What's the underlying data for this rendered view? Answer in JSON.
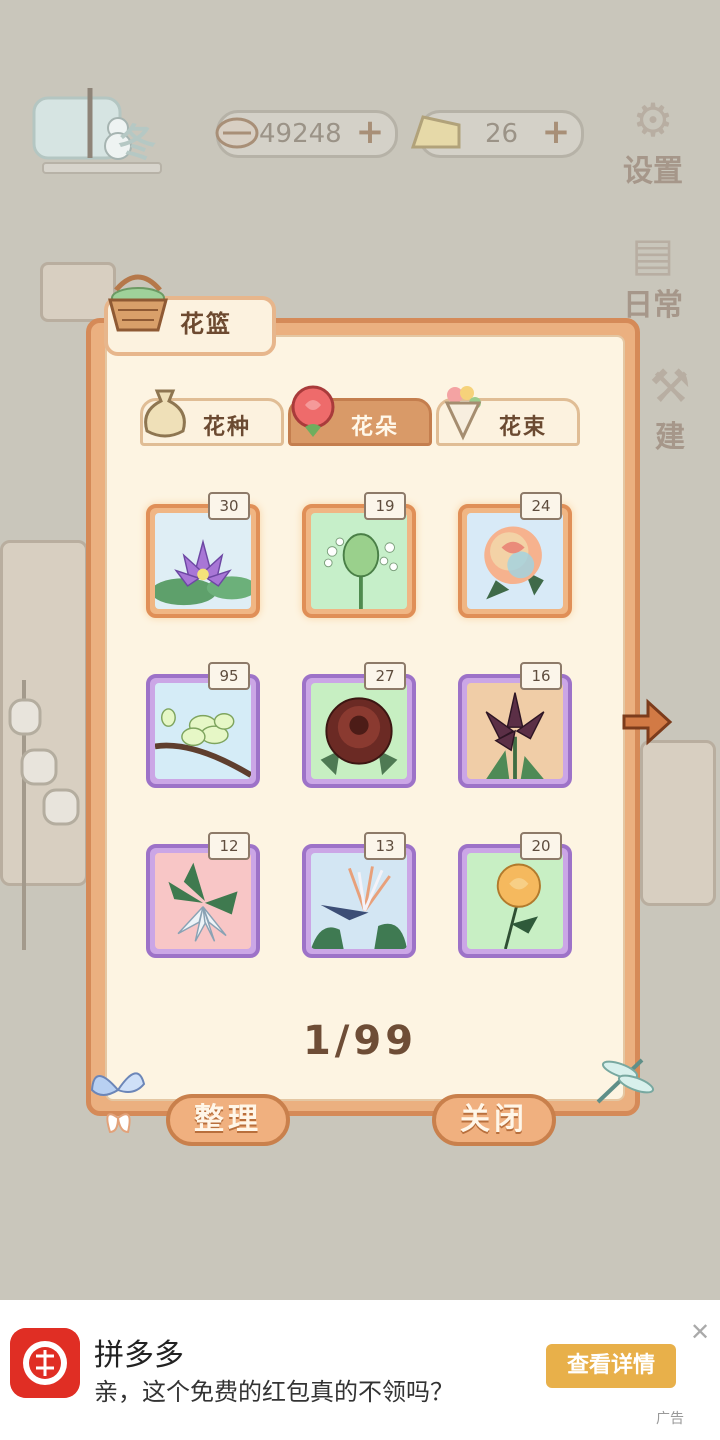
{
  "hud": {
    "season": "冬",
    "fish_count": "49248",
    "cheese_count": "26",
    "plus_symbol": "+",
    "settings_label": "设置",
    "daily_label": "日常",
    "build_label": "建"
  },
  "basket": {
    "title": "花篮",
    "tabs": [
      {
        "label": "花种",
        "active": false,
        "icon": "seed-bag-icon"
      },
      {
        "label": "花朵",
        "active": true,
        "icon": "rose-icon"
      },
      {
        "label": "花束",
        "active": false,
        "icon": "bouquet-icon"
      }
    ],
    "items": [
      {
        "count": "30",
        "flower": "water-lily",
        "frame": "orange",
        "bg": "#dfeef5"
      },
      {
        "count": "19",
        "flower": "green-bud",
        "frame": "orange",
        "bg": "#c6efc9"
      },
      {
        "count": "24",
        "flower": "rainbow-rose",
        "frame": "orange",
        "bg": "#d8eaf7"
      },
      {
        "count": "95",
        "flower": "magnolia-branch",
        "frame": "purple",
        "bg": "#d5ecf7"
      },
      {
        "count": "27",
        "flower": "dark-peony",
        "frame": "purple",
        "bg": "#c7efc2"
      },
      {
        "count": "16",
        "flower": "dark-lily",
        "frame": "purple",
        "bg": "#f0cda7"
      },
      {
        "count": "12",
        "flower": "white-star-lily",
        "frame": "purple",
        "bg": "#f8c6c6"
      },
      {
        "count": "13",
        "flower": "bird-of-paradise",
        "frame": "purple",
        "bg": "#d3e6f3"
      },
      {
        "count": "20",
        "flower": "yellow-rose",
        "frame": "purple",
        "bg": "#c8efc4"
      }
    ],
    "page": "1/99",
    "sort_button": "整理",
    "close_button": "关闭"
  },
  "ad": {
    "app_name": "拼多多",
    "message": "亲，这个免费的红包真的不领吗？",
    "cta": "查看详情",
    "close_symbol": "✕",
    "tag": "广告"
  },
  "colors": {
    "panel": "#ebb080",
    "panel_inner": "#fdf4e2",
    "accent": "#d99a68",
    "ad_brand": "#e02e24",
    "ad_cta": "#e8b04a"
  }
}
